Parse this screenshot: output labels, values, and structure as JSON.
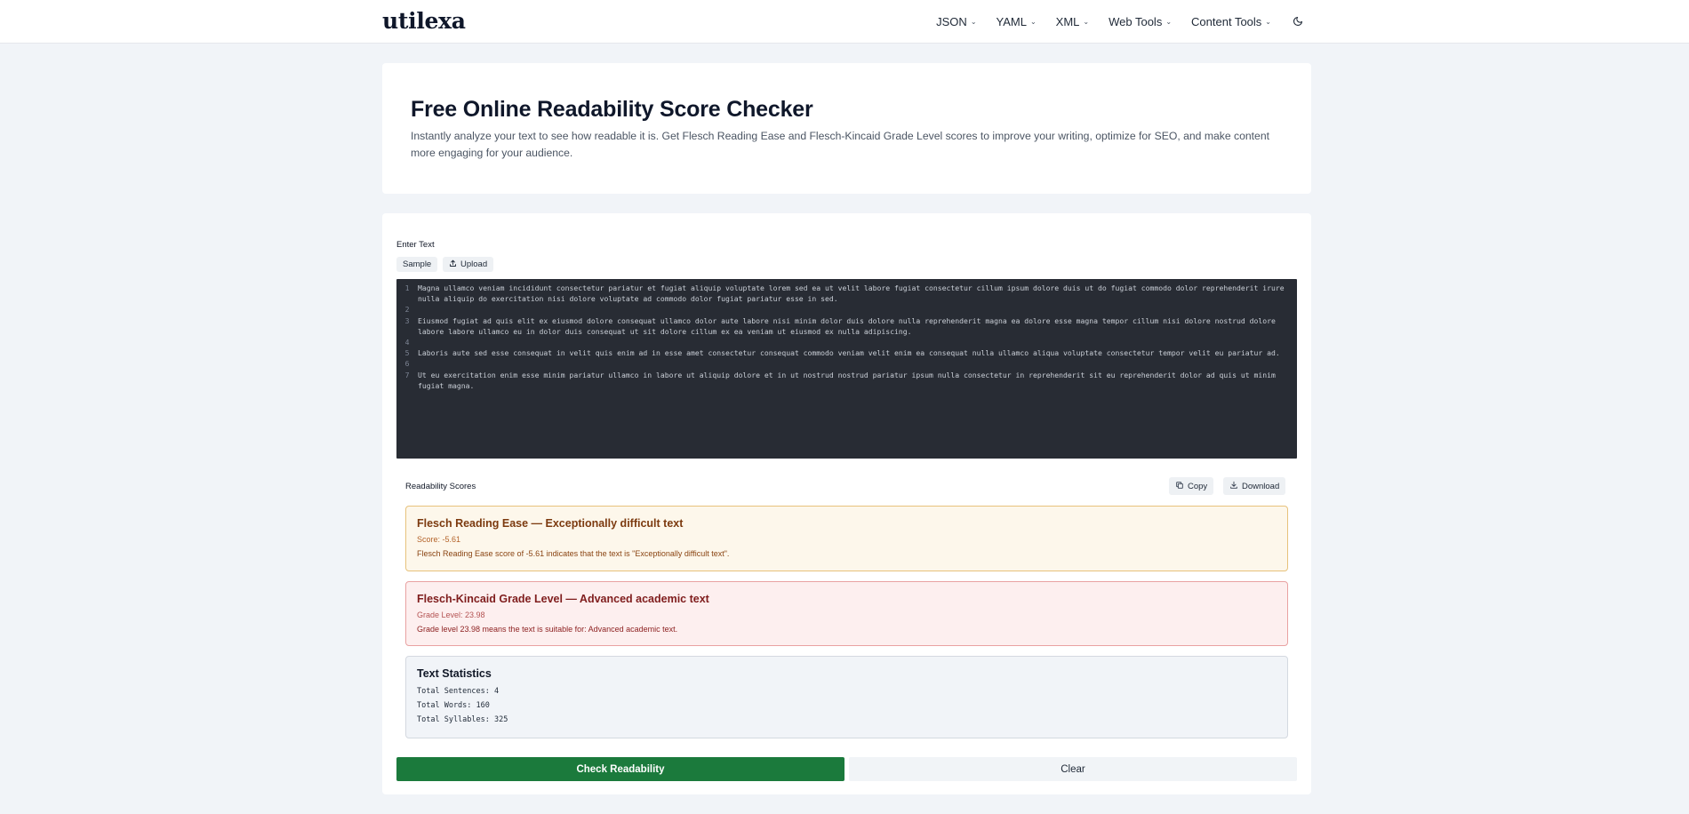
{
  "header": {
    "logo": "utilexa",
    "nav": [
      {
        "label": "JSON"
      },
      {
        "label": "YAML"
      },
      {
        "label": "XML"
      },
      {
        "label": "Web Tools"
      },
      {
        "label": "Content Tools"
      }
    ],
    "theme_icon": "moon-icon"
  },
  "hero": {
    "title": "Free Online Readability Score Checker",
    "description": "Instantly analyze your text to see how readable it is. Get Flesch Reading Ease and Flesch-Kincaid Grade Level scores to improve your writing, optimize for SEO, and make content more engaging for your audience."
  },
  "tool": {
    "input_label": "Enter Text",
    "sample_button": "Sample",
    "upload_button": "Upload",
    "editor_lines": [
      {
        "num": "1",
        "text": "Magna ullamco veniam incididunt consectetur pariatur et fugiat aliquip voluptate lorem sed ea ut velit labore fugiat consectetur cillum ipsum dolore duis ut do fugiat commodo dolor reprehenderit irure nulla aliquip do exercitation nisi dolore voluptate ad commodo dolor fugiat pariatur esse in sed."
      },
      {
        "num": "2",
        "text": ""
      },
      {
        "num": "3",
        "text": "Eiusmod fugiat ad quis elit ex eiusmod dolore consequat ullamco dolor aute labore nisi minim dolor duis dolore nulla reprehenderit magna ea dolore esse magna tempor cillum nisi dolore nostrud dolore labore labore ullamco eu in dolor duis consequat ut sit dolore cillum ex ea veniam ut eiusmod ex nulla adipiscing."
      },
      {
        "num": "4",
        "text": ""
      },
      {
        "num": "5",
        "text": "Laboris aute sed esse consequat in velit quis enim ad in esse amet consectetur consequat commodo veniam velit enim ea consequat nulla ullamco aliqua voluptate consectetur tempor velit eu pariatur ad."
      },
      {
        "num": "6",
        "text": ""
      },
      {
        "num": "7",
        "text": "Ut eu exercitation enim esse minim pariatur ullamco in labore ut aliquip dolore et in ut nostrud nostrud pariatur ipsum nulla consectetur in reprehenderit sit eu reprehenderit dolor ad quis ut minim fugiat magna."
      }
    ],
    "results_label": "Readability Scores",
    "copy_button": "Copy",
    "download_button": "Download",
    "reading_ease": {
      "title": "Flesch Reading Ease — Exceptionally difficult text",
      "score": "Score: -5.61",
      "description": "Flesch Reading Ease score of -5.61 indicates that the text is \"Exceptionally difficult text\"."
    },
    "grade_level": {
      "title": "Flesch-Kincaid Grade Level — Advanced academic text",
      "score": "Grade Level: 23.98",
      "description": "Grade level 23.98 means the text is suitable for: Advanced academic text."
    },
    "statistics": {
      "title": "Text Statistics",
      "sentences": "Total Sentences: 4",
      "words": "Total Words: 160",
      "syllables": "Total Syllables: 325"
    },
    "check_button": "Check Readability",
    "clear_button": "Clear"
  },
  "colors": {
    "primary_green": "#1b7a3c",
    "editor_bg": "#282c34",
    "warning_bg": "#fdf7eb",
    "danger_bg": "#fdefef"
  }
}
